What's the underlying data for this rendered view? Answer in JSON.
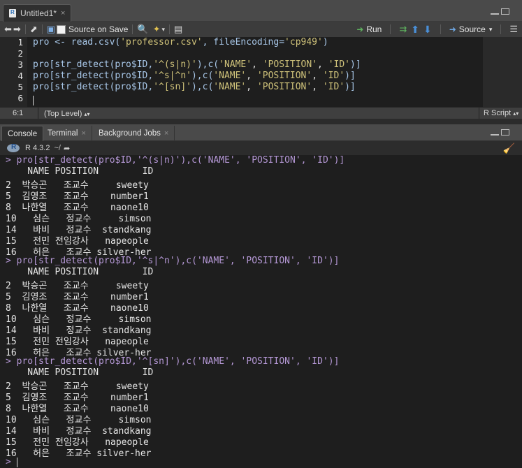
{
  "editor": {
    "tab_title": "Untitled1*",
    "tab_close": "×",
    "toolbar": {
      "source_on_save": "Source on Save",
      "run": "Run",
      "source": "Source"
    },
    "line_numbers": [
      "1",
      "2",
      "3",
      "4",
      "5",
      "6"
    ],
    "code": {
      "l1_a": "pro <- read.csv(",
      "l1_s1": "'professor.csv'",
      "l1_b": ", fileEncoding=",
      "l1_s2": "'cp949'",
      "l1_c": ")",
      "l3_a": "pro[str_detect(pro$ID,",
      "l3_s1": "'^(s|n)'",
      "l3_b": "),c(",
      "l3_s2": "'NAME'",
      "l3_s3": "'POSITION'",
      "l3_s4": "'ID'",
      "l3_c": ")]",
      "l4_s1": "'^s|^n'",
      "l5_s1": "'^[sn]'",
      "sep": ", "
    },
    "status": {
      "position": "6:1",
      "scope": "(Top Level)",
      "language": "R Script"
    }
  },
  "console": {
    "tabs": [
      {
        "label": "Console"
      },
      {
        "label": "Terminal"
      },
      {
        "label": "Background Jobs"
      }
    ],
    "r_version": "R 4.3.2",
    "working_dir": "~/",
    "prompt": ">",
    "commands": [
      "pro[str_detect(pro$ID,'^(s|n)'),c('NAME', 'POSITION', 'ID')]",
      "pro[str_detect(pro$ID,'^s|^n'),c('NAME', 'POSITION', 'ID')]",
      "pro[str_detect(pro$ID,'^[sn]'),c('NAME', 'POSITION', 'ID')]"
    ],
    "header": "    NAME POSITION        ID",
    "rows": [
      "2  박승곤   조교수     sweety",
      "5  김영조   조교수    number1",
      "8  나한열   조교수    naone10",
      "10   심슨   정교수     simson",
      "14   바비   정교수  standkang",
      "15   전민 전임강사   napeople",
      "16   허은   조교수 silver-her"
    ]
  }
}
